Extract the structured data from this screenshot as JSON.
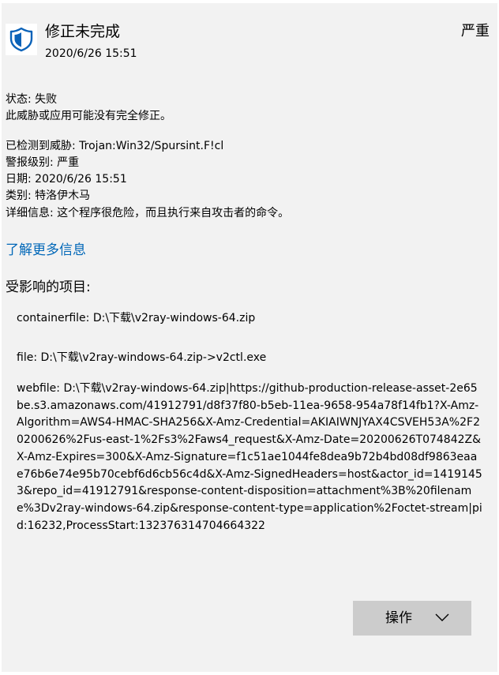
{
  "header": {
    "title": "修正未完成",
    "datetime": "2020/6/26 15:51",
    "severity": "严重",
    "icon": "shield-icon"
  },
  "status": {
    "line": "状态: 失败",
    "description": "此威胁或应用可能没有完全修正。"
  },
  "details": [
    "已检测到威胁: Trojan:Win32/Spursint.F!cl",
    "警报级别: 严重",
    "日期: 2020/6/26 15:51",
    "类别: 特洛伊木马",
    "详细信息: 这个程序很危险，而且执行来自攻击者的命令。"
  ],
  "learn_more": "了解更多信息",
  "affected": {
    "title": "受影响的项目:",
    "items": [
      "containerfile: D:\\下载\\v2ray-windows-64.zip",
      "file: D:\\下载\\v2ray-windows-64.zip->v2ctl.exe",
      "webfile: D:\\下载\\v2ray-windows-64.zip|https://github-production-release-asset-2e65be.s3.amazonaws.com/41912791/d8f37f80-b5eb-11ea-9658-954a78f14fb1?X-Amz-Algorithm=AWS4-HMAC-SHA256&X-Amz-Credential=AKIAIWNJYAX4CSVEH53A%2F20200626%2Fus-east-1%2Fs3%2Faws4_request&X-Amz-Date=20200626T074842Z&X-Amz-Expires=300&X-Amz-Signature=f1c51ae1044fe8dea9b72b4bd08df9863eaae76b6e74e95b70cebf6d6cb56c4d&X-Amz-SignedHeaders=host&actor_id=14191453&repo_id=41912791&response-content-disposition=attachment%3B%20filename%3Dv2ray-windows-64.zip&response-content-type=application%2Foctet-stream|pid:16232,ProcessStart:132376314704664322"
    ]
  },
  "actions": {
    "label": "操作",
    "icon": "chevron-down-icon"
  },
  "colors": {
    "panel_bg": "#f2f2f2",
    "shield_blue": "#0a62b8",
    "link_blue": "#0067b8",
    "button_bg": "#cccccc"
  }
}
